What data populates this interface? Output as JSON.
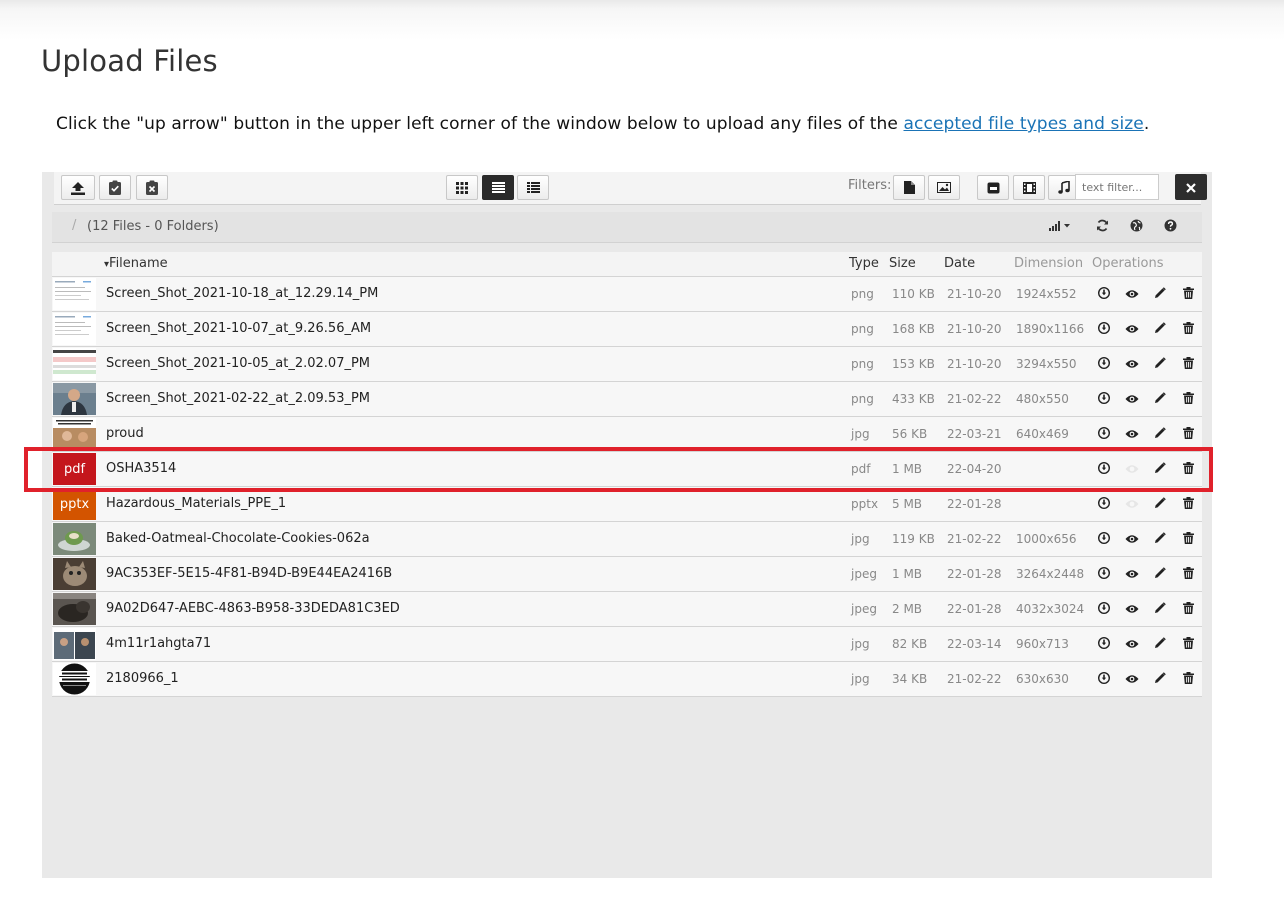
{
  "page": {
    "title": "Upload Files",
    "instruction_prefix": "Click the \"up arrow\" button in the upper left corner of the window below to upload any files of the ",
    "instruction_link": "accepted file types and size",
    "instruction_suffix": "."
  },
  "toolbar": {
    "left_buttons": [
      "upload-icon",
      "clipboard-check-icon",
      "clipboard-x-icon"
    ],
    "view_buttons": [
      "grid-view-icon",
      "list-view-icon",
      "columns-view-icon"
    ],
    "active_view": "list",
    "filters_label": "Filters:",
    "filter_buttons": [
      "file-icon",
      "image-icon",
      "archive-icon",
      "video-icon",
      "music-icon"
    ],
    "text_filter_placeholder": "text filter...",
    "clear_icon": "close-icon"
  },
  "pathbar": {
    "separator": "/",
    "count_text": "(12 Files - 0 Folders)",
    "icons": [
      "sort-icon",
      "refresh-icon",
      "globe-icon",
      "help-icon"
    ]
  },
  "table": {
    "headers": {
      "filename": "Filename",
      "type": "Type",
      "size": "Size",
      "date": "Date",
      "dimension": "Dimension",
      "operations": "Operations"
    },
    "sort_indicator": "▾",
    "rows": [
      {
        "filename": "Screen_Shot_2021-10-18_at_12.29.14_PM",
        "type": "png",
        "size": "110 KB",
        "date": "21-10-20",
        "dimension": "1924x552",
        "thumb": "screenshot-doc",
        "preview": true
      },
      {
        "filename": "Screen_Shot_2021-10-07_at_9.26.56_AM",
        "type": "png",
        "size": "168 KB",
        "date": "21-10-20",
        "dimension": "1890x1166",
        "thumb": "screenshot-doc",
        "preview": true
      },
      {
        "filename": "Screen_Shot_2021-10-05_at_2.02.07_PM",
        "type": "png",
        "size": "153 KB",
        "date": "21-10-20",
        "dimension": "3294x550",
        "thumb": "screenshot-training",
        "preview": true
      },
      {
        "filename": "Screen_Shot_2021-02-22_at_2.09.53_PM",
        "type": "png",
        "size": "433 KB",
        "date": "21-02-22",
        "dimension": "480x550",
        "thumb": "photo-man",
        "preview": true
      },
      {
        "filename": "proud",
        "type": "jpg",
        "size": "56 KB",
        "date": "22-03-21",
        "dimension": "640x469",
        "thumb": "meme",
        "preview": true
      },
      {
        "filename": "OSHA3514",
        "type": "pdf",
        "size": "1 MB",
        "date": "22-04-20",
        "dimension": "",
        "thumb": "pdf",
        "thumb_label": "pdf",
        "preview": false
      },
      {
        "filename": "Hazardous_Materials_PPE_1",
        "type": "pptx",
        "size": "5 MB",
        "date": "22-01-28",
        "dimension": "",
        "thumb": "pptx",
        "thumb_label": "pptx",
        "preview": false
      },
      {
        "filename": "Baked-Oatmeal-Chocolate-Cookies-062a",
        "type": "jpg",
        "size": "119 KB",
        "date": "21-02-22",
        "dimension": "1000x656",
        "thumb": "photo-cookies",
        "preview": true
      },
      {
        "filename": "9AC353EF-5E15-4F81-B94D-B9E44EA2416B",
        "type": "jpeg",
        "size": "1 MB",
        "date": "22-01-28",
        "dimension": "3264x2448",
        "thumb": "photo-cat",
        "preview": true
      },
      {
        "filename": "9A02D647-AEBC-4863-B958-33DEDA81C3ED",
        "type": "jpeg",
        "size": "2 MB",
        "date": "22-01-28",
        "dimension": "4032x3024",
        "thumb": "photo-dog",
        "preview": true
      },
      {
        "filename": "4m11r1ahgta71",
        "type": "jpg",
        "size": "82 KB",
        "date": "22-03-14",
        "dimension": "960x713",
        "thumb": "photo-collage",
        "preview": true
      },
      {
        "filename": "2180966_1",
        "type": "jpg",
        "size": "34 KB",
        "date": "21-02-22",
        "dimension": "630x630",
        "thumb": "logo-dunder",
        "preview": true
      }
    ],
    "operation_icons": [
      "download-icon",
      "preview-eye-icon",
      "edit-pencil-icon",
      "delete-trash-icon"
    ]
  },
  "highlight": {
    "row_filename": "OSHA3514",
    "color": "#e0212b"
  },
  "colors": {
    "pdf": "#c4161c",
    "pptx": "#d35400",
    "link": "#1a73b6"
  }
}
